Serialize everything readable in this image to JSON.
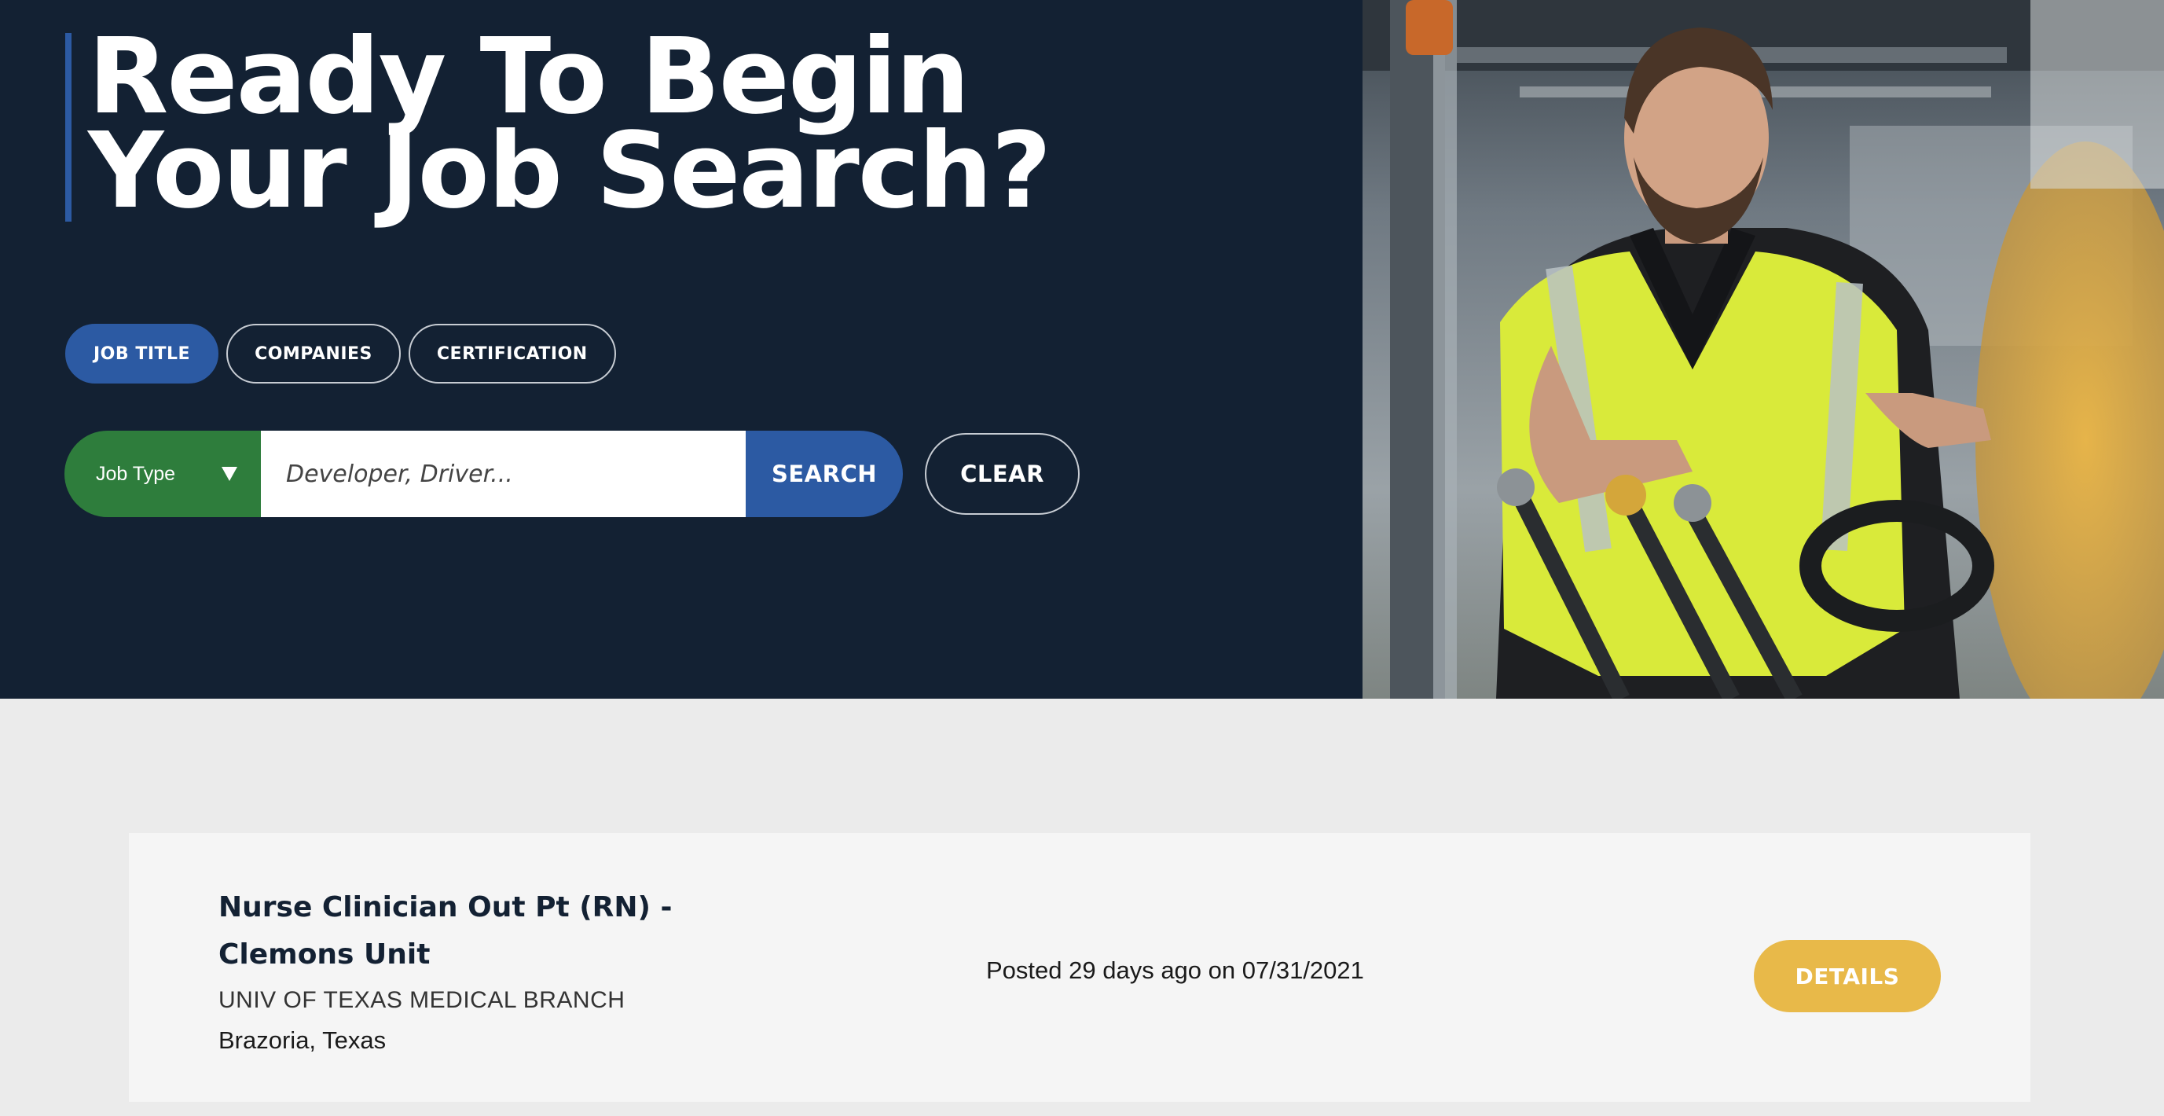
{
  "hero": {
    "headline_line1": "Ready To Begin",
    "headline_line2": "Your Job Search?"
  },
  "tabs": [
    {
      "label": "JOB TITLE",
      "active": true
    },
    {
      "label": "COMPANIES",
      "active": false
    },
    {
      "label": "CERTIFICATION",
      "active": false
    }
  ],
  "search": {
    "job_type_label": "Job Type",
    "placeholder": "Developer, Driver...",
    "search_label": "SEARCH",
    "clear_label": "CLEAR"
  },
  "jobs": [
    {
      "title": "Nurse Clinician Out Pt (RN) - Clemons Unit",
      "company": "UNIV OF TEXAS MEDICAL BRANCH",
      "location": "Brazoria, Texas",
      "posted": "Posted 29 days ago on 07/31/2021",
      "details_label": "DETAILS"
    }
  ],
  "colors": {
    "hero_bg": "#132133",
    "primary_blue": "#2c5aa3",
    "job_type_green": "#2e7d3c",
    "details_gold": "#e8b949",
    "page_bg": "#ebebeb",
    "card_bg": "#f5f5f5"
  }
}
